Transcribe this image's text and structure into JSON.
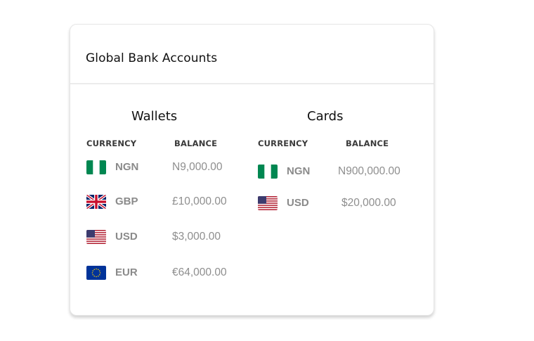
{
  "card": {
    "title": "Global Bank Accounts"
  },
  "wallets": {
    "title": "Wallets",
    "currency_header": "CURRENCY",
    "balance_header": "BALANCE",
    "rows": [
      {
        "code": "NGN",
        "balance": "N9,000.00",
        "flag_icon": "nigeria-flag-icon"
      },
      {
        "code": "GBP",
        "balance": "£10,000.00",
        "flag_icon": "uk-flag-icon"
      },
      {
        "code": "USD",
        "balance": "$3,000.00",
        "flag_icon": "us-flag-icon"
      },
      {
        "code": "EUR",
        "balance": "€64,000.00",
        "flag_icon": "eu-flag-icon"
      }
    ]
  },
  "cards": {
    "title": "Cards",
    "currency_header": "CURRENCY",
    "balance_header": "BALANCE",
    "rows": [
      {
        "code": "NGN",
        "balance": "N900,000.00",
        "flag_icon": "nigeria-flag-icon"
      },
      {
        "code": "USD",
        "balance": "$20,000.00",
        "flag_icon": "us-flag-icon"
      }
    ]
  },
  "colors": {
    "title_text": "#111111",
    "muted_text": "#8a8a8a",
    "header_text": "#3a3a3a",
    "nigeria_green": "#008751",
    "eu_blue": "#003399"
  }
}
